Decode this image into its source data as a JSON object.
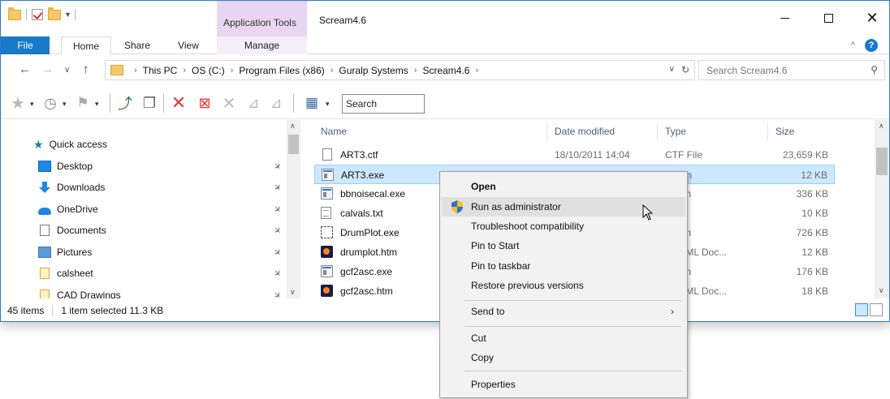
{
  "window": {
    "title": "Scream4.6",
    "contextual_tab_group": "Application Tools"
  },
  "ribbon": {
    "tabs": [
      "File",
      "Home",
      "Share",
      "View",
      "Manage"
    ],
    "help": "?"
  },
  "address": {
    "crumbs": [
      "This PC",
      "OS (C:)",
      "Program Files (x86)",
      "Guralp Systems",
      "Scream4.6"
    ],
    "search_placeholder": "Search Scream4.6"
  },
  "toolbar": {
    "search_placeholder": "Search"
  },
  "nav_pane": {
    "quick_access": "Quick access",
    "items": [
      {
        "label": "Desktop",
        "icon": "desktop-icon"
      },
      {
        "label": "Downloads",
        "icon": "download-icon"
      },
      {
        "label": "OneDrive",
        "icon": "onedrive-icon"
      },
      {
        "label": "Documents",
        "icon": "documents-icon"
      },
      {
        "label": "Pictures",
        "icon": "pictures-icon"
      },
      {
        "label": "calsheet",
        "icon": "file-icon"
      },
      {
        "label": "CAD Drawings",
        "icon": "file-icon"
      }
    ]
  },
  "file_list": {
    "columns": [
      "Name",
      "Date modified",
      "Type",
      "Size"
    ],
    "rows": [
      {
        "name": "ART3.ctf",
        "date": "18/10/2011 14:04",
        "type": "CTF File",
        "size": "23,659 KB",
        "icon": "blank"
      },
      {
        "name": "ART3.exe",
        "date": "",
        "type": "cation",
        "size": "12 KB",
        "icon": "exe",
        "selected": true
      },
      {
        "name": "bbnoisecal.exe",
        "date": "",
        "type": "cation",
        "size": "336 KB",
        "icon": "exe"
      },
      {
        "name": "calvals.txt",
        "date": "",
        "type": "File",
        "size": "10 KB",
        "icon": "txt"
      },
      {
        "name": "DrumPlot.exe",
        "date": "",
        "type": "cation",
        "size": "726 KB",
        "icon": "drum"
      },
      {
        "name": "drumplot.htm",
        "date": "",
        "type": "x HTML Doc...",
        "size": "12 KB",
        "icon": "htm"
      },
      {
        "name": "gcf2asc.exe",
        "date": "",
        "type": "cation",
        "size": "176 KB",
        "icon": "exe"
      },
      {
        "name": "gcf2asc.htm",
        "date": "",
        "type": "x HTML Doc...",
        "size": "18 KB",
        "icon": "htm"
      }
    ]
  },
  "status": {
    "count": "45 items",
    "selection": "1 item selected  11.3 KB"
  },
  "context_menu": {
    "items": [
      "Open",
      "Run as administrator",
      "Troubleshoot compatibility",
      "Pin to Start",
      "Pin to taskbar",
      "Restore previous versions",
      "Send to",
      "Cut",
      "Copy",
      "Properties"
    ]
  },
  "colors": {
    "accent": "#1979ca",
    "selection": "#cce8ff",
    "contextual_tab": "#e8d6f2"
  }
}
